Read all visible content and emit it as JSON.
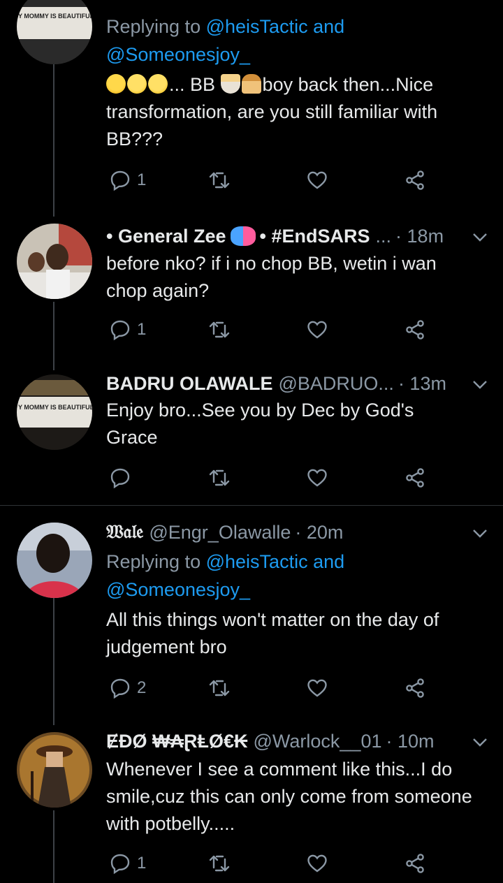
{
  "tweets": [
    {
      "replying_prefix": "Replying to",
      "mention1": "@heisTactic",
      "and_word": "and",
      "mention2": "@Someonesjoy_",
      "text_after_emoji": "... BB",
      "text_after_food": "boy back then...Nice",
      "text_line2": "transformation, are you still familiar with",
      "text_line3": "BB???",
      "reply_count": "1",
      "avatar_text": "Y MOMMY IS BEAUTIFUL"
    },
    {
      "name_prefix": "• General Zee",
      "name_suffix": "• #EndSARS",
      "name_ellipsis": "...",
      "time": "· 18m",
      "text": "before nko? if i no chop BB, wetin i wan chop again?",
      "reply_count": "1"
    },
    {
      "name": "BADRU OLAWALE",
      "handle": "@BADRUO...",
      "time": "· 13m",
      "text": "Enjoy bro...See you by Dec by God's Grace",
      "reply_count": "",
      "avatar_text": "Y MOMMY IS BEAUTIFUL"
    },
    {
      "name": "𝔚𝔞𝔩𝔢",
      "handle": "@Engr_Olawalle",
      "time": "· 20m",
      "replying_prefix": "Replying to",
      "mention1": "@heisTactic",
      "and_word": "and",
      "mention2": "@Someonesjoy_",
      "text": "All this things won't matter on the day of judgement bro",
      "reply_count": "2"
    },
    {
      "name": "ɆĐØ ₩₳ⱤⱠØ€₭",
      "handle": "@Warlock__01",
      "time": "· 10m",
      "text": "Whenever I see a comment like this...I do smile,cuz this can only come from someone with potbelly.....",
      "reply_count": "1"
    }
  ],
  "colors": {
    "background": "#000000",
    "text": "#e7e9ea",
    "muted": "#8b98a5",
    "link": "#1d9bf0",
    "divider": "#2f3336"
  },
  "icons": [
    "reply-icon",
    "retweet-icon",
    "like-icon",
    "share-icon",
    "chevron-down-icon"
  ]
}
